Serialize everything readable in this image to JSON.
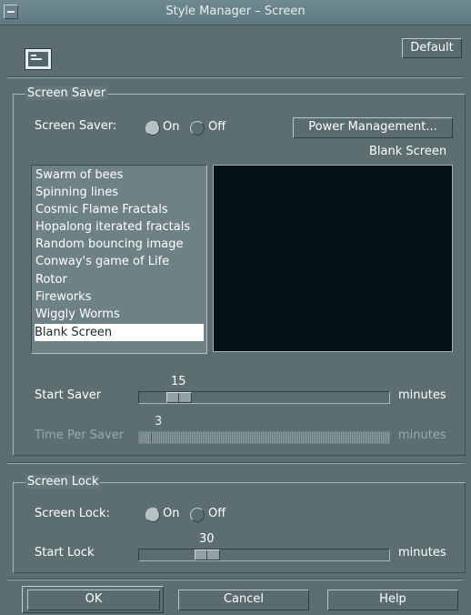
{
  "window": {
    "title": "Style Manager – Screen"
  },
  "toolbar": {
    "default_label": "Default"
  },
  "screen_saver": {
    "group_label": "Screen Saver",
    "toggle_label": "Screen Saver:",
    "on_label": "On",
    "off_label": "Off",
    "selected": "On",
    "power_button": "Power Management...",
    "preview_label": "Blank Screen",
    "list": [
      "Swarm of bees",
      "Spinning lines",
      "Cosmic Flame Fractals",
      "Hopalong iterated fractals",
      "Random bouncing image",
      "Conway's game of Life",
      "Rotor",
      "Fireworks",
      "Wiggly Worms",
      "Blank Screen"
    ],
    "selected_item": "Blank Screen",
    "start_saver": {
      "label": "Start Saver",
      "value": "15",
      "unit": "minutes"
    },
    "time_per_saver": {
      "label": "Time Per Saver",
      "value": "3",
      "unit": "minutes",
      "enabled": false
    }
  },
  "screen_lock": {
    "group_label": "Screen Lock",
    "toggle_label": "Screen Lock:",
    "on_label": "On",
    "off_label": "Off",
    "selected": "On",
    "start_lock": {
      "label": "Start Lock",
      "value": "30",
      "unit": "minutes"
    }
  },
  "footer": {
    "ok": "OK",
    "cancel": "Cancel",
    "help": "Help"
  },
  "colors": {
    "background": "#5d6e70",
    "titlebar": "#6f8a91",
    "selection": "#ffffff",
    "preview": "#031215"
  }
}
